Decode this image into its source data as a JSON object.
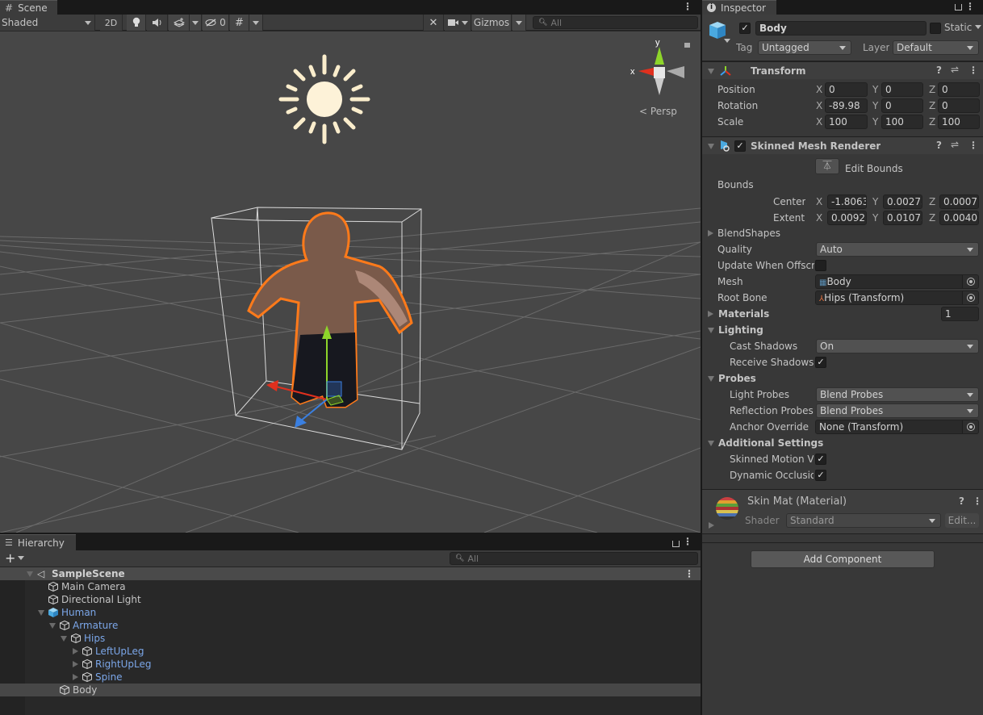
{
  "scene": {
    "tab_label": "Scene",
    "toolbar": {
      "shading_mode": "Shaded",
      "mode_2d": "2D",
      "hidden_count": "0",
      "gizmos_label": "Gizmos",
      "search_placeholder": "All"
    },
    "gizmo": {
      "x_label": "x",
      "y_label": "y",
      "projection": "Persp"
    }
  },
  "inspector": {
    "tab_label": "Inspector",
    "object": {
      "name": "Body",
      "active": true,
      "static_label": "Static",
      "static": false,
      "tag_label": "Tag",
      "tag_value": "Untagged",
      "layer_label": "Layer",
      "layer_value": "Default"
    },
    "transform": {
      "title": "Transform",
      "rows": [
        {
          "label": "Position",
          "x": "0",
          "y": "0",
          "z": "0"
        },
        {
          "label": "Rotation",
          "x": "-89.98",
          "y": "0",
          "z": "0"
        },
        {
          "label": "Scale",
          "x": "100",
          "y": "100",
          "z": "100"
        }
      ]
    },
    "axis_labels": {
      "x": "X",
      "y": "Y",
      "z": "Z"
    },
    "skinned_mesh_renderer": {
      "title": "Skinned Mesh Renderer",
      "enabled": true,
      "edit_bounds_label": "Edit Bounds",
      "bounds_label": "Bounds",
      "center": {
        "label": "Center",
        "x": "-1.8063",
        "y": "0.00273",
        "z": "0.0007:"
      },
      "extent": {
        "label": "Extent",
        "x": "0.0092:",
        "y": "0.01073",
        "z": "0.0040"
      },
      "blendshapes_label": "BlendShapes",
      "quality_label": "Quality",
      "quality_value": "Auto",
      "update_offscreen_label": "Update When Offscre",
      "update_offscreen": false,
      "mesh_label": "Mesh",
      "mesh_value": "Body",
      "root_bone_label": "Root Bone",
      "root_bone_value": "Hips (Transform)",
      "materials_label": "Materials",
      "materials_count": "1",
      "lighting_label": "Lighting",
      "cast_shadows_label": "Cast Shadows",
      "cast_shadows_value": "On",
      "receive_shadows_label": "Receive Shadows",
      "receive_shadows": true,
      "probes_label": "Probes",
      "light_probes_label": "Light Probes",
      "light_probes_value": "Blend Probes",
      "reflection_probes_label": "Reflection Probes",
      "reflection_probes_value": "Blend Probes",
      "anchor_override_label": "Anchor Override",
      "anchor_override_value": "None (Transform)",
      "additional_settings_label": "Additional Settings",
      "skinned_motion_label": "Skinned Motion Ve",
      "skinned_motion": true,
      "dynamic_occlusion_label": "Dynamic Occlusioi",
      "dynamic_occlusion": true
    },
    "material": {
      "title": "Skin Mat (Material)",
      "shader_label": "Shader",
      "shader_value": "Standard",
      "edit_label": "Edit..."
    },
    "add_component_label": "Add Component"
  },
  "hierarchy": {
    "tab_label": "Hierarchy",
    "search_placeholder": "All",
    "scene_name": "SampleScene",
    "items": [
      {
        "label": "Main Camera",
        "depth": 1,
        "expand": "none",
        "prefab": false
      },
      {
        "label": "Directional Light",
        "depth": 1,
        "expand": "none",
        "prefab": false
      },
      {
        "label": "Human",
        "depth": 1,
        "expand": "open",
        "prefab": true
      },
      {
        "label": "Armature",
        "depth": 2,
        "expand": "open",
        "prefab": true
      },
      {
        "label": "Hips",
        "depth": 3,
        "expand": "open",
        "prefab": true
      },
      {
        "label": "LeftUpLeg",
        "depth": 4,
        "expand": "closed",
        "prefab": true
      },
      {
        "label": "RightUpLeg",
        "depth": 4,
        "expand": "closed",
        "prefab": true
      },
      {
        "label": "Spine",
        "depth": 4,
        "expand": "closed",
        "prefab": true
      },
      {
        "label": "Body",
        "depth": 2,
        "expand": "none",
        "prefab": false,
        "selected": true
      }
    ]
  },
  "colors": {
    "selection_outline": "#ff7a1a",
    "axis_x": "#e0301e",
    "axis_y": "#8ed52a",
    "axis_z": "#3a7fe0",
    "prefab_text": "#7ba6e8"
  }
}
